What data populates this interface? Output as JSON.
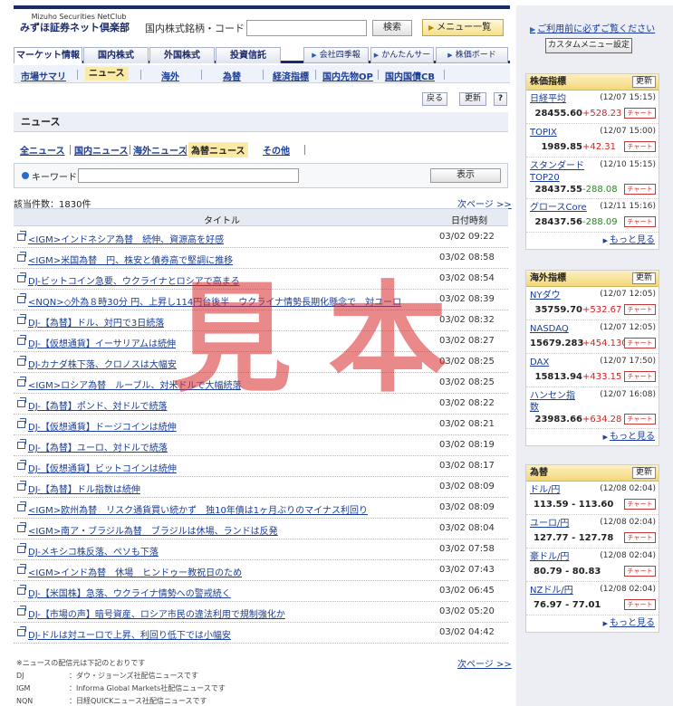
{
  "header": {
    "brand_top": "Mizuho Securities NetClub",
    "brand_main": "みずほ証券ネット倶楽部",
    "code_label": "国内株式銘柄・コード",
    "code_value": "",
    "search_label": "検索",
    "menu_label": "メニュー一覧"
  },
  "tabs": [
    {
      "label": "マーケット情報",
      "active": true
    },
    {
      "label": "国内株式"
    },
    {
      "label": "外国株式"
    },
    {
      "label": "投資信託"
    }
  ],
  "tab_links": [
    "会社四季報",
    "かんたんサーチ",
    "株価ボード"
  ],
  "subnav": [
    {
      "label": "市場サマリ"
    },
    {
      "label": "ニュース",
      "active": true
    },
    {
      "label": "海外"
    },
    {
      "label": "為替"
    },
    {
      "label": "経済指標"
    },
    {
      "label": "国内先物OP"
    },
    {
      "label": "国内国債CB"
    }
  ],
  "actions": {
    "back": "戻る",
    "refresh": "更新",
    "help": "?"
  },
  "news_title": "ニュース",
  "categories": [
    {
      "label": "全ニュース"
    },
    {
      "label": "国内ニュース"
    },
    {
      "label": "海外ニュース"
    },
    {
      "label": "為替ニュース",
      "active": true
    },
    {
      "label": "その他"
    }
  ],
  "keyword": {
    "label": "キーワード",
    "value": "",
    "button": "表示"
  },
  "count": "該当件数：1830件",
  "next_page": "次ページ >>",
  "table": {
    "col_title": "タイトル",
    "col_date": "日付時刻"
  },
  "news": [
    {
      "title": "<IGM>インドネシア為替　続伸、資源高を好感",
      "date": "03/02 09:22"
    },
    {
      "title": "<IGM>米国為替　円、株安と債券高で堅調に推移",
      "date": "03/02 08:58"
    },
    {
      "title": "DJ-ビットコイン急要、ウクライナとロシアで高まる",
      "date": "03/02 08:54"
    },
    {
      "title": "<NQN>◇外為８時30分 円、上昇し114円台後半　ウクライナ情勢長期化懸念で　対ユーロ",
      "date": "03/02 08:39"
    },
    {
      "title": "DJ-【為替】ドル、対円で3日続落",
      "date": "03/02 08:32"
    },
    {
      "title": "DJ-【仮想通貨】イーサリアムは続伸",
      "date": "03/02 08:27"
    },
    {
      "title": "DJ-カナダ株下落、クロノスは大幅安",
      "date": "03/02 08:25"
    },
    {
      "title": "<IGM>ロシア為替　ルーブル、対米ドルで大幅続落",
      "date": "03/02 08:25"
    },
    {
      "title": "DJ-【為替】ポンド、対ドルで続落",
      "date": "03/02 08:22"
    },
    {
      "title": "DJ-【仮想通貨】ドージコインは続伸",
      "date": "03/02 08:21"
    },
    {
      "title": "DJ-【為替】ユーロ、対ドルで続落",
      "date": "03/02 08:19"
    },
    {
      "title": "DJ-【仮想通貨】ビットコインは続伸",
      "date": "03/02 08:17"
    },
    {
      "title": "DJ-【為替】ドル指数は続伸",
      "date": "03/02 08:09"
    },
    {
      "title": "<IGM>欧州為替　リスク通貨買い続かず　独10年債は1ヶ月ぶりのマイナス利回り",
      "date": "03/02 08:09"
    },
    {
      "title": "<IGM>南ア・ブラジル為替　ブラジルは休場、ランドは反発",
      "date": "03/02 08:04"
    },
    {
      "title": "DJ-メキシコ株反落、ペソも下落",
      "date": "03/02 07:58"
    },
    {
      "title": "<IGM>インド為替　休場　ヒンドゥー教祝日のため",
      "date": "03/02 07:43"
    },
    {
      "title": "DJ-【米国株】急落、ウクライナ情勢への警戒続く",
      "date": "03/02 06:45"
    },
    {
      "title": "DJ-【市場の声】暗号資産、ロシア市民の違法利用で規制強化か",
      "date": "03/02 05:20"
    },
    {
      "title": "DJ-ドルは対ユーロで上昇、利回り低下では小幅安",
      "date": "03/02 04:42"
    }
  ],
  "notes": {
    "intro": "※ニュースの配信元は下記のとおりです",
    "sources": [
      {
        "key": "DJ",
        "text": "：ダウ・ジョーンズ社配信ニュースです"
      },
      {
        "key": "IGM",
        "text": "：Informa Global Markets社配信ニュースです"
      },
      {
        "key": "NQN",
        "text": "：日経QUICKニュース社配信ニュースです"
      }
    ]
  },
  "watermark": "見本",
  "sidebar": {
    "notice": "ご利用前に必ずご覧ください",
    "custom_menu": "カスタムメニュー設定",
    "update_label": "更新",
    "chart_label": "チャート",
    "more_label": "もっと見る",
    "panels": [
      {
        "title": "株価指標",
        "items": [
          {
            "name": "日経平均",
            "time": "(12/07 15:15)",
            "value": "28455.60",
            "change": "+528.23",
            "dir": "up"
          },
          {
            "name": "TOPIX",
            "time": "(12/07 15:00)",
            "value": "1989.85",
            "change": "+42.31",
            "dir": "up"
          },
          {
            "name": "スタンダード",
            "name2": "TOP20",
            "time": "(12/10 15:15)",
            "value": "28437.55",
            "change": "-288.08",
            "dir": "down"
          },
          {
            "name": "グロースCore",
            "time": "(12/11 15:16)",
            "value": "28437.56",
            "change": "-288.09",
            "dir": "down"
          }
        ]
      },
      {
        "title": "海外指標",
        "items": [
          {
            "name": "NYダウ",
            "time": "(12/07 12:05)",
            "value": "35759.70",
            "change": "+532.67",
            "dir": "up"
          },
          {
            "name": "NASDAQ",
            "time": "(12/07 12:05)",
            "value": "15679.283",
            "change": "+454.130",
            "dir": "up"
          },
          {
            "name": "DAX",
            "time": "(12/07 17:50)",
            "value": "15813.94",
            "change": "+433.15",
            "dir": "up"
          },
          {
            "name": "ハンセン指",
            "name2": "数",
            "time": "(12/07 16:08)",
            "value": "23983.66",
            "change": "+634.28",
            "dir": "up"
          }
        ]
      },
      {
        "title": "為替",
        "items": [
          {
            "name": "ドル/円",
            "time": "(12/08 02:04)",
            "value": "113.59 - 113.60"
          },
          {
            "name": "ユーロ/円",
            "time": "(12/08 02:04)",
            "value": "127.77 - 127.78"
          },
          {
            "name": "豪ドル/円",
            "time": "(12/08 02:04)",
            "value": "80.79 - 80.83"
          },
          {
            "name": "NZドル/円",
            "time": "(12/08 02:04)",
            "value": "76.97 - 77.01"
          }
        ]
      }
    ]
  }
}
